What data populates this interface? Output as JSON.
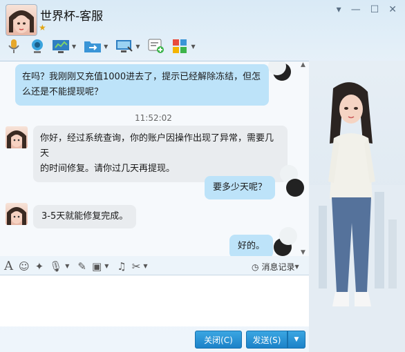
{
  "window": {
    "title": "世界杯-客服",
    "controls": [
      "minimize-icon",
      "maximize-icon",
      "close-icon"
    ]
  },
  "toolbar": {
    "icons": [
      "microphone-icon",
      "video-camera-icon",
      "screen-share-icon",
      "file-transfer-icon",
      "remote-desktop-icon",
      "message-add-icon",
      "apps-grid-icon"
    ]
  },
  "chat": {
    "messages": [
      {
        "from": "me",
        "text_line1": "在吗？我刚刚又充值1000进去了，提示已经解除冻结，但怎",
        "text_line2": "么还是不能提现呢？"
      },
      {
        "from": "them",
        "text_line1": "你好，经过系统查询，你的账户因操作出现了异常，需要几天",
        "text_line2": "的时间修复。请你过几天再提现。"
      },
      {
        "from": "me",
        "text": "要多少天呢？"
      },
      {
        "from": "them",
        "text": "3-5天就能修复完成。"
      },
      {
        "from": "me",
        "text": "好的。"
      }
    ],
    "timestamp": "11:52:02"
  },
  "editor": {
    "icons": [
      "font-icon",
      "emoji-icon",
      "magic-icon",
      "voice-icon",
      "edit-icon",
      "image-icon",
      "music-icon",
      "scissors-icon"
    ],
    "history_label": "消息记录"
  },
  "buttons": {
    "close": "关闭(C)",
    "send": "发送(S)"
  },
  "colors": {
    "bubble_mine": "#bde3f9",
    "bubble_theirs": "#e9ecef",
    "button_blue": "#1c82c8"
  }
}
